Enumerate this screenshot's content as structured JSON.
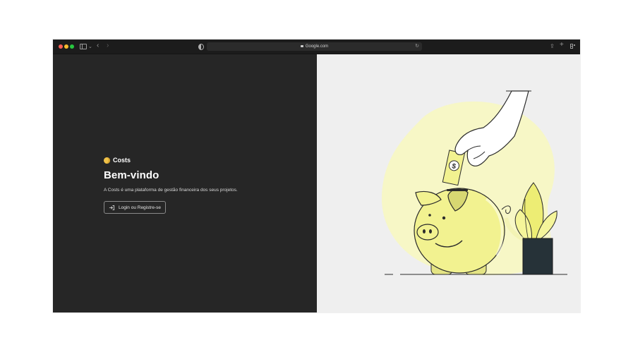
{
  "browser": {
    "url": "Google.com",
    "icons": [
      "sidebar-icon",
      "chevron-down-icon",
      "back-icon",
      "forward-icon",
      "shield-icon",
      "lock-icon",
      "reload-icon",
      "share-icon",
      "new-tab-icon",
      "tab-overview-icon"
    ]
  },
  "hero": {
    "brand": "Costs",
    "title": "Bem-vindo",
    "subtitle": "A Costs é uma plataforma de gestão financeira dos seus projetos.",
    "login_label": "Login ou Registre-se",
    "login_icon": "login-icon"
  },
  "colors": {
    "left_bg": "#262626",
    "right_bg": "#efefef",
    "accent_yellow": "#f7f7a8",
    "coin": "#f0c24a"
  }
}
